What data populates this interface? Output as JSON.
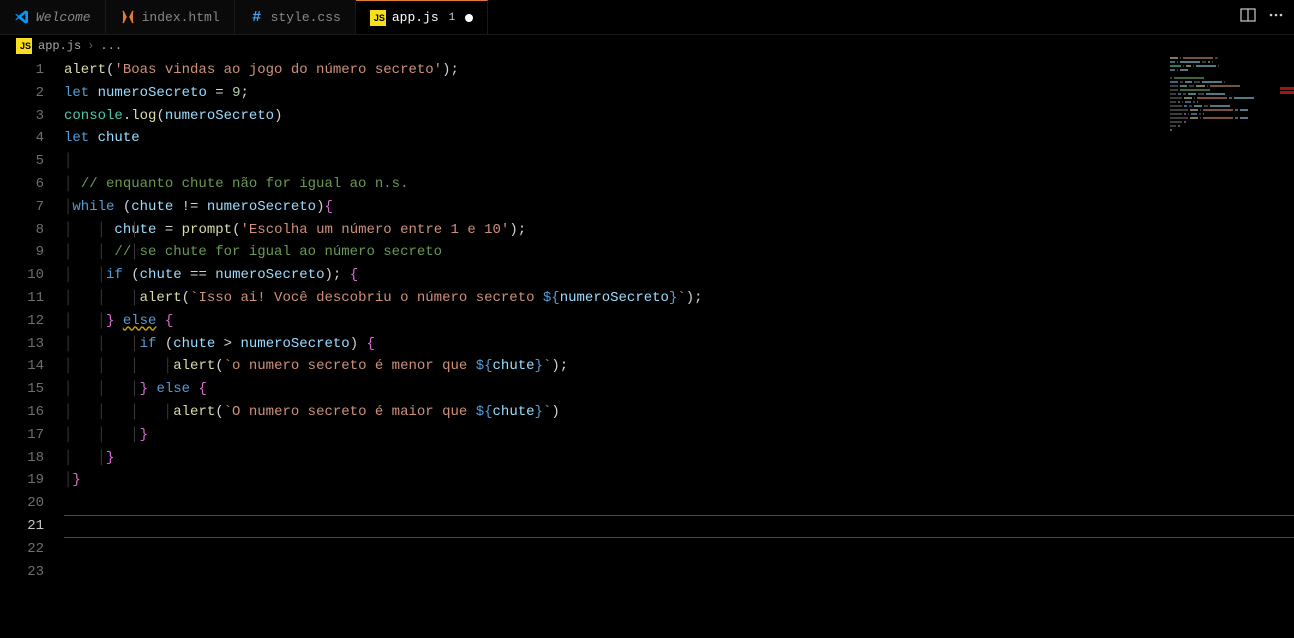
{
  "tabs": [
    {
      "label": "Welcome",
      "iconType": "vscode",
      "italic": true
    },
    {
      "label": "index.html",
      "iconType": "html"
    },
    {
      "label": "style.css",
      "iconType": "css"
    },
    {
      "label": "app.js",
      "iconType": "js",
      "active": true,
      "badge": "1",
      "modified": true
    }
  ],
  "breadcrumb": {
    "fileIcon": "js",
    "file": "app.js",
    "separator": "›",
    "scope": "..."
  },
  "lineCount": 23,
  "activeLine": 21,
  "code": [
    [
      {
        "t": "fn",
        "v": "alert"
      },
      {
        "t": "pun",
        "v": "("
      },
      {
        "t": "str",
        "v": "'Boas vindas ao jogo do número secreto'"
      },
      {
        "t": "pun",
        "v": ");"
      }
    ],
    [
      {
        "t": "kw",
        "v": "let"
      },
      {
        "t": "pun",
        "v": " "
      },
      {
        "t": "var",
        "v": "numeroSecreto"
      },
      {
        "t": "pun",
        "v": " = "
      },
      {
        "t": "num",
        "v": "9"
      },
      {
        "t": "pun",
        "v": ";"
      }
    ],
    [
      {
        "t": "cls",
        "v": "console"
      },
      {
        "t": "pun",
        "v": "."
      },
      {
        "t": "fn",
        "v": "log"
      },
      {
        "t": "pun",
        "v": "("
      },
      {
        "t": "var",
        "v": "numeroSecreto"
      },
      {
        "t": "pun",
        "v": ")"
      }
    ],
    [
      {
        "t": "kw",
        "v": "let"
      },
      {
        "t": "pun",
        "v": " "
      },
      {
        "t": "var",
        "v": "chute"
      }
    ],
    [],
    [
      {
        "t": "pun",
        "v": " "
      },
      {
        "t": "cmt",
        "v": "// enquanto chute não for igual ao n.s."
      }
    ],
    [
      {
        "t": "kw",
        "v": "while"
      },
      {
        "t": "pun",
        "v": " ("
      },
      {
        "t": "var",
        "v": "chute"
      },
      {
        "t": "pun",
        "v": " != "
      },
      {
        "t": "var",
        "v": "numeroSecreto"
      },
      {
        "t": "pun",
        "v": ")"
      },
      {
        "t": "brace",
        "v": "{"
      }
    ],
    [
      {
        "t": "pun",
        "v": "     "
      },
      {
        "t": "var",
        "v": "chute"
      },
      {
        "t": "pun",
        "v": " = "
      },
      {
        "t": "fn",
        "v": "prompt"
      },
      {
        "t": "pun",
        "v": "("
      },
      {
        "t": "str",
        "v": "'Escolha um número entre 1 e 10'"
      },
      {
        "t": "pun",
        "v": ");"
      }
    ],
    [
      {
        "t": "pun",
        "v": "     "
      },
      {
        "t": "cmt",
        "v": "// se chute for igual ao número secreto"
      }
    ],
    [
      {
        "t": "pun",
        "v": "    "
      },
      {
        "t": "kw",
        "v": "if"
      },
      {
        "t": "pun",
        "v": " ("
      },
      {
        "t": "var",
        "v": "chute"
      },
      {
        "t": "pun",
        "v": " == "
      },
      {
        "t": "var",
        "v": "numeroSecreto"
      },
      {
        "t": "pun",
        "v": "); "
      },
      {
        "t": "brace",
        "v": "{"
      }
    ],
    [
      {
        "t": "pun",
        "v": "        "
      },
      {
        "t": "fn",
        "v": "alert"
      },
      {
        "t": "pun",
        "v": "("
      },
      {
        "t": "str",
        "v": "`Isso ai! Você descobriu o número secreto "
      },
      {
        "t": "embed",
        "v": "${"
      },
      {
        "t": "var",
        "v": "numeroSecreto"
      },
      {
        "t": "embed",
        "v": "}"
      },
      {
        "t": "str",
        "v": "`"
      },
      {
        "t": "pun",
        "v": ");"
      }
    ],
    [
      {
        "t": "pun",
        "v": "    "
      },
      {
        "t": "brace",
        "v": "}"
      },
      {
        "t": "pun",
        "v": " "
      },
      {
        "t": "kw",
        "v": "else",
        "squiggle": true
      },
      {
        "t": "pun",
        "v": " "
      },
      {
        "t": "brace",
        "v": "{"
      }
    ],
    [
      {
        "t": "pun",
        "v": "        "
      },
      {
        "t": "kw",
        "v": "if"
      },
      {
        "t": "pun",
        "v": " ("
      },
      {
        "t": "var",
        "v": "chute"
      },
      {
        "t": "pun",
        "v": " > "
      },
      {
        "t": "var",
        "v": "numeroSecreto"
      },
      {
        "t": "pun",
        "v": ") "
      },
      {
        "t": "brace",
        "v": "{"
      }
    ],
    [
      {
        "t": "pun",
        "v": "            "
      },
      {
        "t": "fn",
        "v": "alert"
      },
      {
        "t": "pun",
        "v": "("
      },
      {
        "t": "str",
        "v": "`o numero secreto é menor que "
      },
      {
        "t": "embed",
        "v": "${"
      },
      {
        "t": "var",
        "v": "chute"
      },
      {
        "t": "embed",
        "v": "}"
      },
      {
        "t": "str",
        "v": "`"
      },
      {
        "t": "pun",
        "v": ");"
      }
    ],
    [
      {
        "t": "pun",
        "v": "        "
      },
      {
        "t": "brace",
        "v": "}"
      },
      {
        "t": "pun",
        "v": " "
      },
      {
        "t": "kw",
        "v": "else"
      },
      {
        "t": "pun",
        "v": " "
      },
      {
        "t": "brace",
        "v": "{"
      }
    ],
    [
      {
        "t": "pun",
        "v": "            "
      },
      {
        "t": "fn",
        "v": "alert"
      },
      {
        "t": "pun",
        "v": "("
      },
      {
        "t": "str",
        "v": "`O numero secreto é maior que "
      },
      {
        "t": "embed",
        "v": "${"
      },
      {
        "t": "var",
        "v": "chute"
      },
      {
        "t": "embed",
        "v": "}"
      },
      {
        "t": "str",
        "v": "`"
      },
      {
        "t": "pun",
        "v": ")"
      }
    ],
    [
      {
        "t": "pun",
        "v": "        "
      },
      {
        "t": "brace",
        "v": "}"
      }
    ],
    [
      {
        "t": "pun",
        "v": "    "
      },
      {
        "t": "brace",
        "v": "}"
      }
    ],
    [
      {
        "t": "brace",
        "v": "}"
      }
    ],
    [],
    [],
    [],
    []
  ],
  "indentGuides": [
    0,
    0,
    0,
    0,
    0,
    0,
    0,
    2,
    2,
    1,
    2,
    1,
    2,
    3,
    2,
    3,
    2,
    1,
    0,
    0,
    0,
    0,
    0
  ],
  "scrollErrors": [
    30,
    34
  ]
}
